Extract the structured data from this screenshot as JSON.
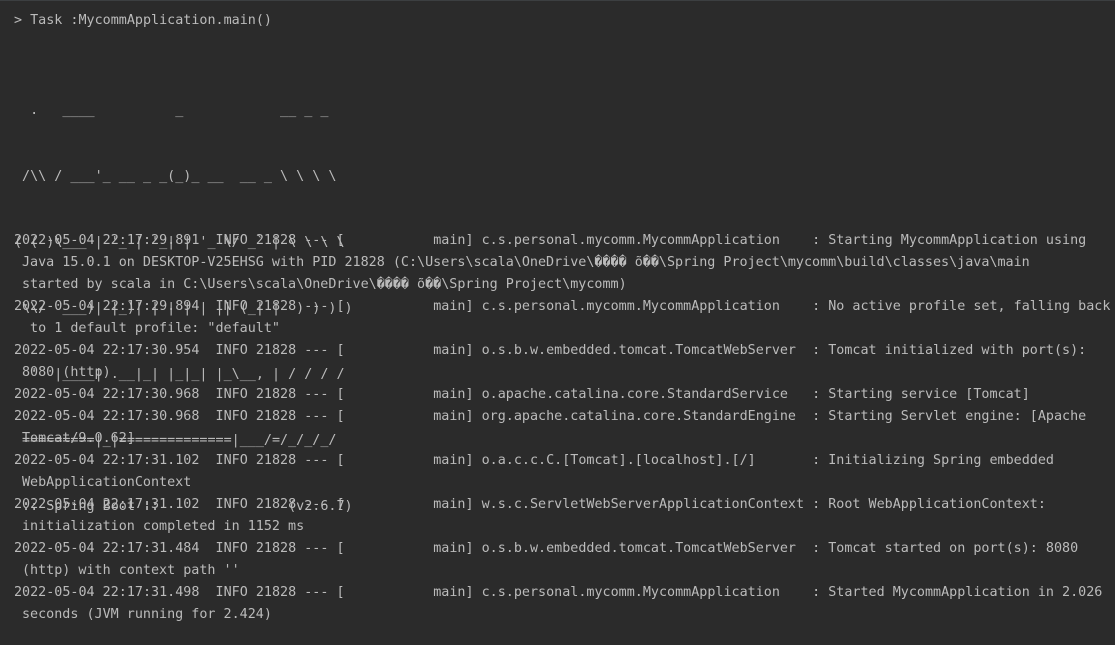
{
  "task_line": "> Task :MycommApplication.main()",
  "banner": [
    "  .   ____          _            __ _ _",
    " /\\\\ / ___'_ __ _ _(_)_ __  __ _ \\ \\ \\ \\",
    "( ( )\\___ | '_ | '_| | '_ \\/ _` | \\ \\ \\ \\",
    " \\\\/  ___)| |_)| | | | | || (_| |  ) ) ) )",
    "  '  |____| .__|_| |_|_| |_\\__, | / / / /",
    " =========|_|==============|___/=/_/_/_/",
    " :: Spring Boot ::                (v2.6.7)"
  ],
  "log": [
    {
      "line": "2022-05-04 22:17:29.891  INFO 21828 --- [           main] c.s.personal.mycomm.MycommApplication    : Starting MycommApplication using",
      "cont": [
        "Java 15.0.1 on DESKTOP-V25EHSG with PID 21828 (C:\\Users\\scala\\OneDrive\\���� õ��\\Spring Project\\mycomm\\build\\classes\\java\\main",
        "started by scala in C:\\Users\\scala\\OneDrive\\���� õ��\\Spring Project\\mycomm)"
      ]
    },
    {
      "line": "2022-05-04 22:17:29.894  INFO 21828 --- [           main] c.s.personal.mycomm.MycommApplication    : No active profile set, falling back",
      "cont": [
        " to 1 default profile: \"default\""
      ]
    },
    {
      "line": "2022-05-04 22:17:30.954  INFO 21828 --- [           main] o.s.b.w.embedded.tomcat.TomcatWebServer  : Tomcat initialized with port(s):",
      "cont": [
        "8080 (http)"
      ]
    },
    {
      "line": "2022-05-04 22:17:30.968  INFO 21828 --- [           main] o.apache.catalina.core.StandardService   : Starting service [Tomcat]",
      "cont": []
    },
    {
      "line": "2022-05-04 22:17:30.968  INFO 21828 --- [           main] org.apache.catalina.core.StandardEngine  : Starting Servlet engine: [Apache",
      "cont": [
        "Tomcat/9.0.62]"
      ]
    },
    {
      "line": "2022-05-04 22:17:31.102  INFO 21828 --- [           main] o.a.c.c.C.[Tomcat].[localhost].[/]       : Initializing Spring embedded",
      "cont": [
        "WebApplicationContext"
      ]
    },
    {
      "line": "2022-05-04 22:17:31.102  INFO 21828 --- [           main] w.s.c.ServletWebServerApplicationContext : Root WebApplicationContext:",
      "cont": [
        "initialization completed in 1152 ms"
      ]
    },
    {
      "line": "2022-05-04 22:17:31.484  INFO 21828 --- [           main] o.s.b.w.embedded.tomcat.TomcatWebServer  : Tomcat started on port(s): 8080",
      "cont": [
        "(http) with context path ''"
      ]
    },
    {
      "line": "2022-05-04 22:17:31.498  INFO 21828 --- [           main] c.s.personal.mycomm.MycommApplication    : Started MycommApplication in 2.026",
      "cont": [
        "seconds (JVM running for 2.424)"
      ]
    }
  ],
  "colors": {
    "background": "#2b2b2b",
    "text": "#bbbbbb"
  }
}
